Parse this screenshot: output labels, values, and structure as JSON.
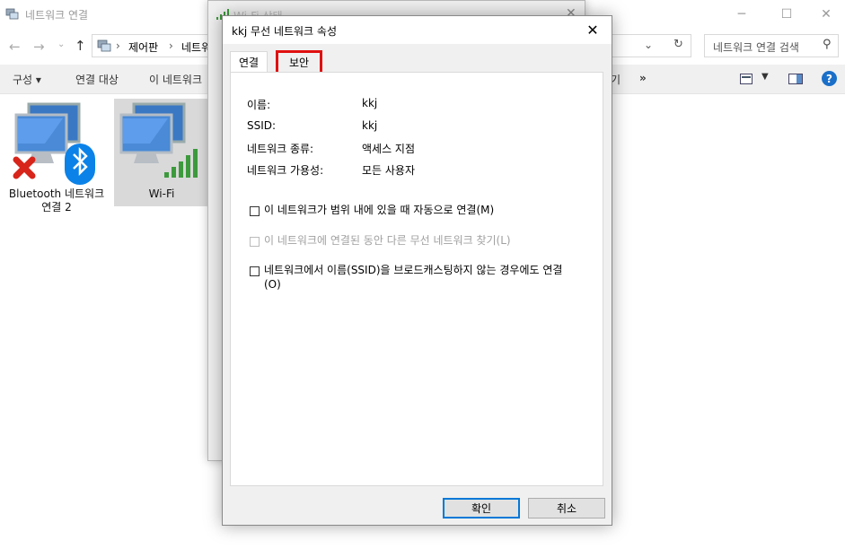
{
  "explorer": {
    "title": "네트워크 연결",
    "breadcrumb": [
      "제어판",
      "네트워"
    ],
    "search_placeholder": "네트워크 연결 검색",
    "commands": [
      "구성 ▾",
      "연결 대상",
      "이 네트워크",
      "기",
      "»"
    ],
    "tiles": [
      {
        "label": "Bluetooth 네트워크 연결 2"
      },
      {
        "label": "Wi-Fi"
      }
    ]
  },
  "wifi_status": {
    "title": "Wi-Fi 상태"
  },
  "dialog": {
    "title": "kkj 무선 네트워크 속성",
    "close_label": "✕",
    "tabs": [
      "연결",
      "보안"
    ],
    "info": [
      {
        "label": "이름:",
        "value": "kkj"
      },
      {
        "label": "SSID:",
        "value": "kkj"
      },
      {
        "label": "네트워크 종류:",
        "value": "액세스 지점"
      },
      {
        "label": "네트워크 가용성:",
        "value": "모든 사용자"
      }
    ],
    "options": [
      {
        "label": "이 네트워크가 범위 내에 있을 때 자동으로 연결(M)",
        "checked": false,
        "enabled": true
      },
      {
        "label": "이 네트워크에 연결된 동안 다른 무선 네트워크 찾기(L)",
        "checked": false,
        "enabled": false
      },
      {
        "label": "네트워크에서 이름(SSID)을 브로드캐스팅하지 않는 경우에도 연결(O)",
        "checked": false,
        "enabled": true
      }
    ],
    "ok_label": "확인",
    "cancel_label": "취소"
  },
  "colors": {
    "highlight_border": "#e01010",
    "primary_button_border": "#0078d7"
  }
}
